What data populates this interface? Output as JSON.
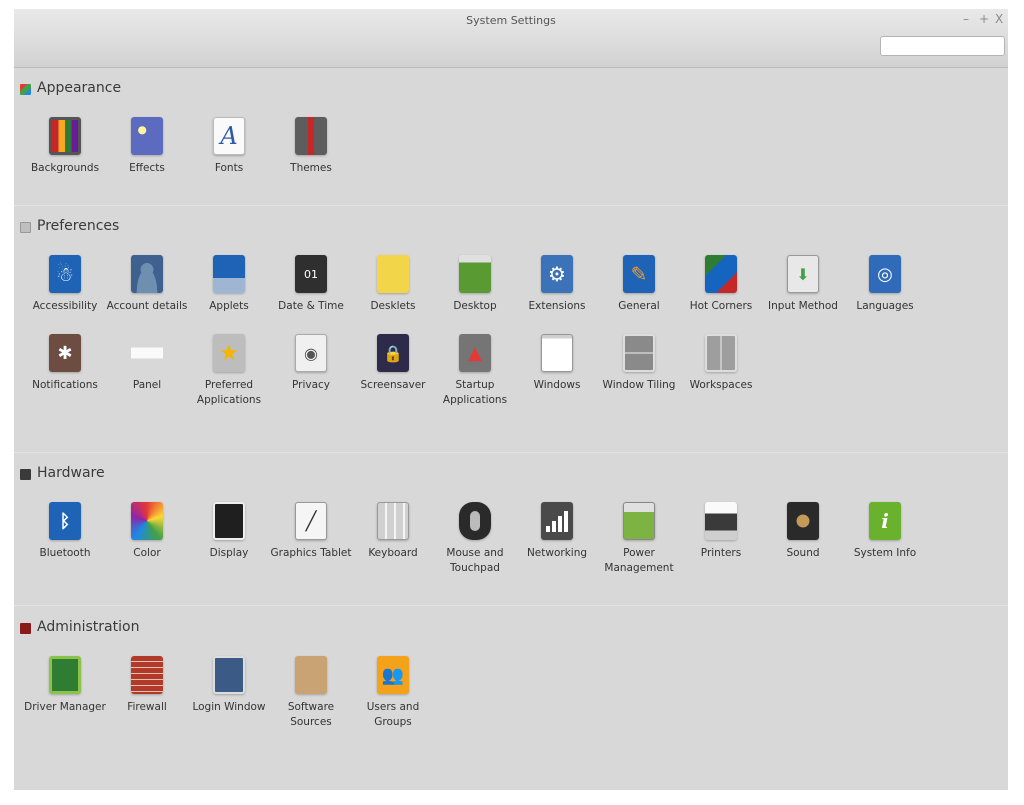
{
  "window": {
    "title": "System Settings",
    "controls": [
      "–",
      "+",
      "X"
    ]
  },
  "search": {
    "value": ""
  },
  "sections": [
    {
      "title": "Appearance",
      "items": [
        {
          "label": "Backgrounds"
        },
        {
          "label": "Effects"
        },
        {
          "label": "Fonts"
        },
        {
          "label": "Themes"
        }
      ]
    },
    {
      "title": "Preferences",
      "items": [
        {
          "label": "Accessibility"
        },
        {
          "label": "Account details"
        },
        {
          "label": "Applets"
        },
        {
          "label": "Date & Time"
        },
        {
          "label": "Desklets"
        },
        {
          "label": "Desktop"
        },
        {
          "label": "Extensions"
        },
        {
          "label": "General"
        },
        {
          "label": "Hot Corners"
        },
        {
          "label": "Input Method"
        },
        {
          "label": "Languages"
        },
        {
          "label": "Notifications"
        },
        {
          "label": "Panel"
        },
        {
          "label": "Preferred\nApplications"
        },
        {
          "label": "Privacy"
        },
        {
          "label": "Screensaver"
        },
        {
          "label": "Startup\nApplications"
        },
        {
          "label": "Windows"
        },
        {
          "label": "Window Tiling"
        },
        {
          "label": "Workspaces"
        }
      ]
    },
    {
      "title": "Hardware",
      "items": [
        {
          "label": "Bluetooth"
        },
        {
          "label": "Color"
        },
        {
          "label": "Display"
        },
        {
          "label": "Graphics Tablet"
        },
        {
          "label": "Keyboard"
        },
        {
          "label": "Mouse and\nTouchpad"
        },
        {
          "label": "Networking"
        },
        {
          "label": "Power\nManagement"
        },
        {
          "label": "Printers"
        },
        {
          "label": "Sound"
        },
        {
          "label": "System Info"
        }
      ]
    },
    {
      "title": "Administration",
      "items": [
        {
          "label": "Driver Manager"
        },
        {
          "label": "Firewall"
        },
        {
          "label": "Login Window"
        },
        {
          "label": "Software\nSources"
        },
        {
          "label": "Users and\nGroups"
        }
      ]
    }
  ]
}
